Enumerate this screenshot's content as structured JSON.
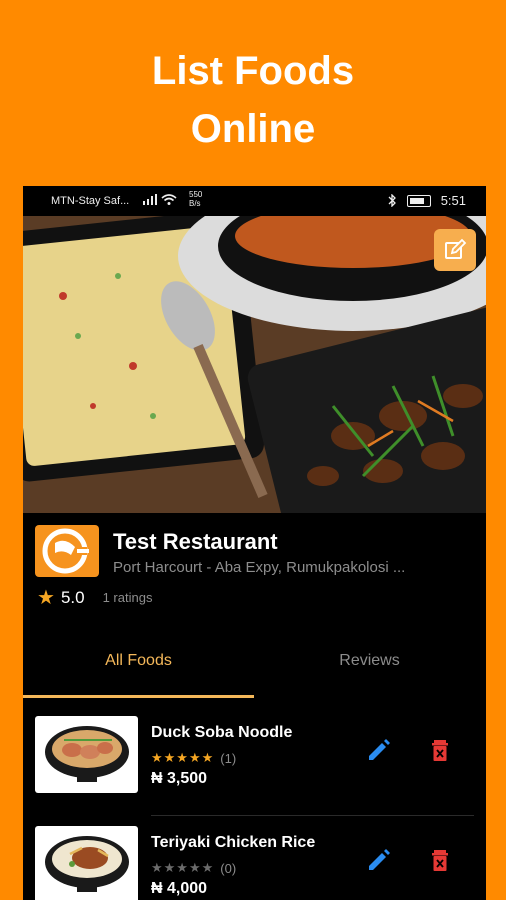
{
  "headline": {
    "line1": "List Foods",
    "line2": "Online"
  },
  "status_bar": {
    "carrier": "MTN-Stay Saf...",
    "net_speed_value": "550",
    "net_speed_unit": "B/s",
    "time": "5:51"
  },
  "restaurant": {
    "name": "Test Restaurant",
    "address": "Port Harcourt - Aba Expy, Rumukpakolosi ...",
    "rating": "5.0",
    "ratings_count": "1 ratings"
  },
  "tabs": [
    {
      "label": "All Foods",
      "active": true
    },
    {
      "label": "Reviews",
      "active": false
    }
  ],
  "foods": [
    {
      "name": "Duck Soba Noodle",
      "stars": 5,
      "rating_count": "(1)",
      "price": "₦ 3,500"
    },
    {
      "name": "Teriyaki Chicken Rice",
      "stars": 0,
      "rating_count": "(0)",
      "price": "₦ 4,000"
    }
  ],
  "colors": {
    "background": "#FF8A00",
    "accent": "#F5B85A",
    "edit_icon": "#2A8CF0",
    "delete_icon": "#E53935",
    "star_filled": "#F5A623",
    "star_empty": "#6b6b6b"
  },
  "icons": {
    "edit_fab": "edit-square-icon",
    "star": "star-icon",
    "edit": "pencil-icon",
    "delete": "trash-icon"
  }
}
